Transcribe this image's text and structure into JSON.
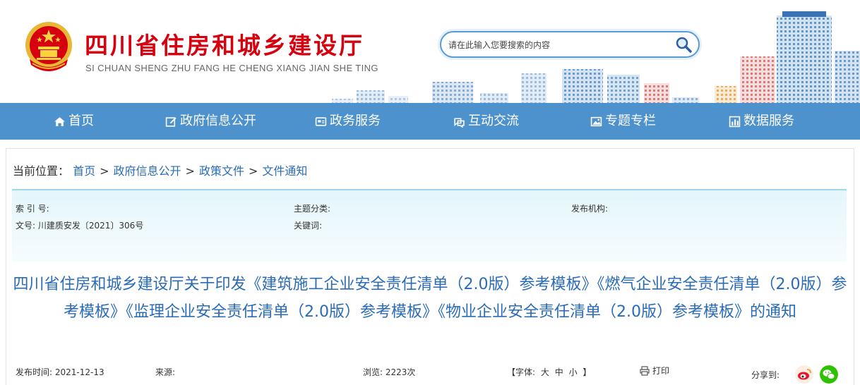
{
  "site": {
    "title": "四川省住房和城乡建设厅",
    "subtitle": "SI CHUAN SHENG ZHU FANG HE CHENG XIANG JIAN SHE TING"
  },
  "search": {
    "placeholder": "请在此输入您要搜索的内容"
  },
  "nav": {
    "items": [
      {
        "label": "首页",
        "icon": "home-icon"
      },
      {
        "label": "政府信息公开",
        "icon": "edit-icon"
      },
      {
        "label": "政务服务",
        "icon": "service-icon"
      },
      {
        "label": "互动交流",
        "icon": "interaction-icon"
      },
      {
        "label": "专题专栏",
        "icon": "image-icon"
      },
      {
        "label": "数据服务",
        "icon": "chart-icon"
      }
    ]
  },
  "breadcrumb": {
    "prefix": "当前位置：",
    "items": [
      "首页",
      "政府信息公开",
      "政策文件",
      "文件通知"
    ],
    "separator": ">"
  },
  "meta": {
    "index_label": "索 引 号:",
    "index_value": "",
    "topic_label": "主题分类:",
    "topic_value": "",
    "org_label": "发布机构:",
    "org_value": "",
    "docno_label": "文号:",
    "docno_value": "川建质安发〔2021〕306号",
    "keywords_label": "关键词:",
    "keywords_value": ""
  },
  "doc": {
    "title": "四川省住房和城乡建设厅关于印发《建筑施工企业安全责任清单（2.0版）参考模板》《燃气企业安全责任清单（2.0版）参考模板》《监理企业安全责任清单（2.0版）参考模板》《物业企业安全责任清单（2.0版）参考模板》的通知"
  },
  "info": {
    "date_label": "发布时间:",
    "date_value": "2021-12-13",
    "source_label": "来源:",
    "views_label": "浏览:",
    "views_value": "2223次",
    "font_label": "【字体:",
    "font_large": "大",
    "font_medium": "中",
    "font_small": "小",
    "font_close": "】",
    "print_label": "打印",
    "share_label": "分享到:"
  },
  "colors": {
    "brand_red": "#d6000f",
    "nav_blue": "#3e88c9",
    "link_blue": "#2a6bb7",
    "meta_bg": "#e4f6fc"
  }
}
